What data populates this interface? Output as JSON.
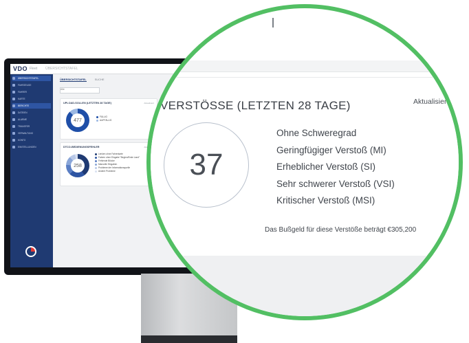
{
  "app": {
    "logo": "VDO",
    "logo_sub": "Fleet",
    "breadcrumb": "ÜBERSICHTSTAFEL",
    "tabs": [
      {
        "label": "ÜBERSICHTSTAFEL",
        "active": true
      },
      {
        "label": "SUCHE",
        "active": false
      }
    ],
    "filter_value": "Alle",
    "sidebar_items": [
      {
        "label": "ÜBERSICHTSTAFEL",
        "active": true
      },
      {
        "label": "FAHRZEUGE",
        "active": false
      },
      {
        "label": "FAHRER",
        "active": false
      },
      {
        "label": "KARTE",
        "active": false
      },
      {
        "label": "BERICHTE",
        "active": true
      },
      {
        "label": "DATEIEN",
        "active": false
      },
      {
        "label": "ALARME",
        "active": false
      },
      {
        "label": "TRANSFER",
        "active": false
      },
      {
        "label": "VERWALTUNG",
        "active": false
      },
      {
        "label": "KONTO",
        "active": false
      },
      {
        "label": "EINSTELLUNGEN",
        "active": false
      }
    ],
    "card1": {
      "title": "UPLOAD-SOLLEN (LETZTEN 28 TAGE)",
      "meta": "Aktualisiert",
      "total": "477",
      "legend": [
        {
          "label": "FÄLLIG",
          "color": "#1f4fa8"
        },
        {
          "label": "AUFFÄLLIG",
          "color": "#9bb8e3"
        }
      ]
    },
    "card2": {
      "title": "DTCO-BEDIENUNGSFEHLER",
      "meta": "Aktualisiert",
      "total": "258",
      "legend": [
        {
          "label": "Lenken ohne Fahrerkarte",
          "color": "#1f3a72"
        },
        {
          "label": "Fahren ohne Eingabe \"Beginn/Ende Land\"",
          "color": "#2e55a3"
        },
        {
          "label": "Fehlende Blöcke",
          "color": "#5b7fc4"
        },
        {
          "label": "Manuelle Eingaben",
          "color": "#8aa6d8"
        },
        {
          "label": "Probleme der Informationsquelle",
          "color": "#b9c9e8"
        },
        {
          "label": "Andere Probleme",
          "color": "#d9e1f1"
        }
      ]
    }
  },
  "magnified": {
    "title": "VERSTÖSSE (LETZTEN 28 TAGE)",
    "refresh": "Aktualisier",
    "total": "37",
    "categories": [
      "Ohne Schweregrad",
      "Geringfügiger Verstoß (MI)",
      "Erheblicher Verstoß (SI)",
      "Sehr schwerer Verstoß (VSI)",
      "Kritischer Verstoß (MSI)"
    ],
    "fine_text": "Das Bußgeld für diese Verstöße beträgt €305,200"
  },
  "colors": {
    "accent": "#52bf63",
    "sidebar": "#1f3a72",
    "donut_primary": "#1f4fa8"
  }
}
